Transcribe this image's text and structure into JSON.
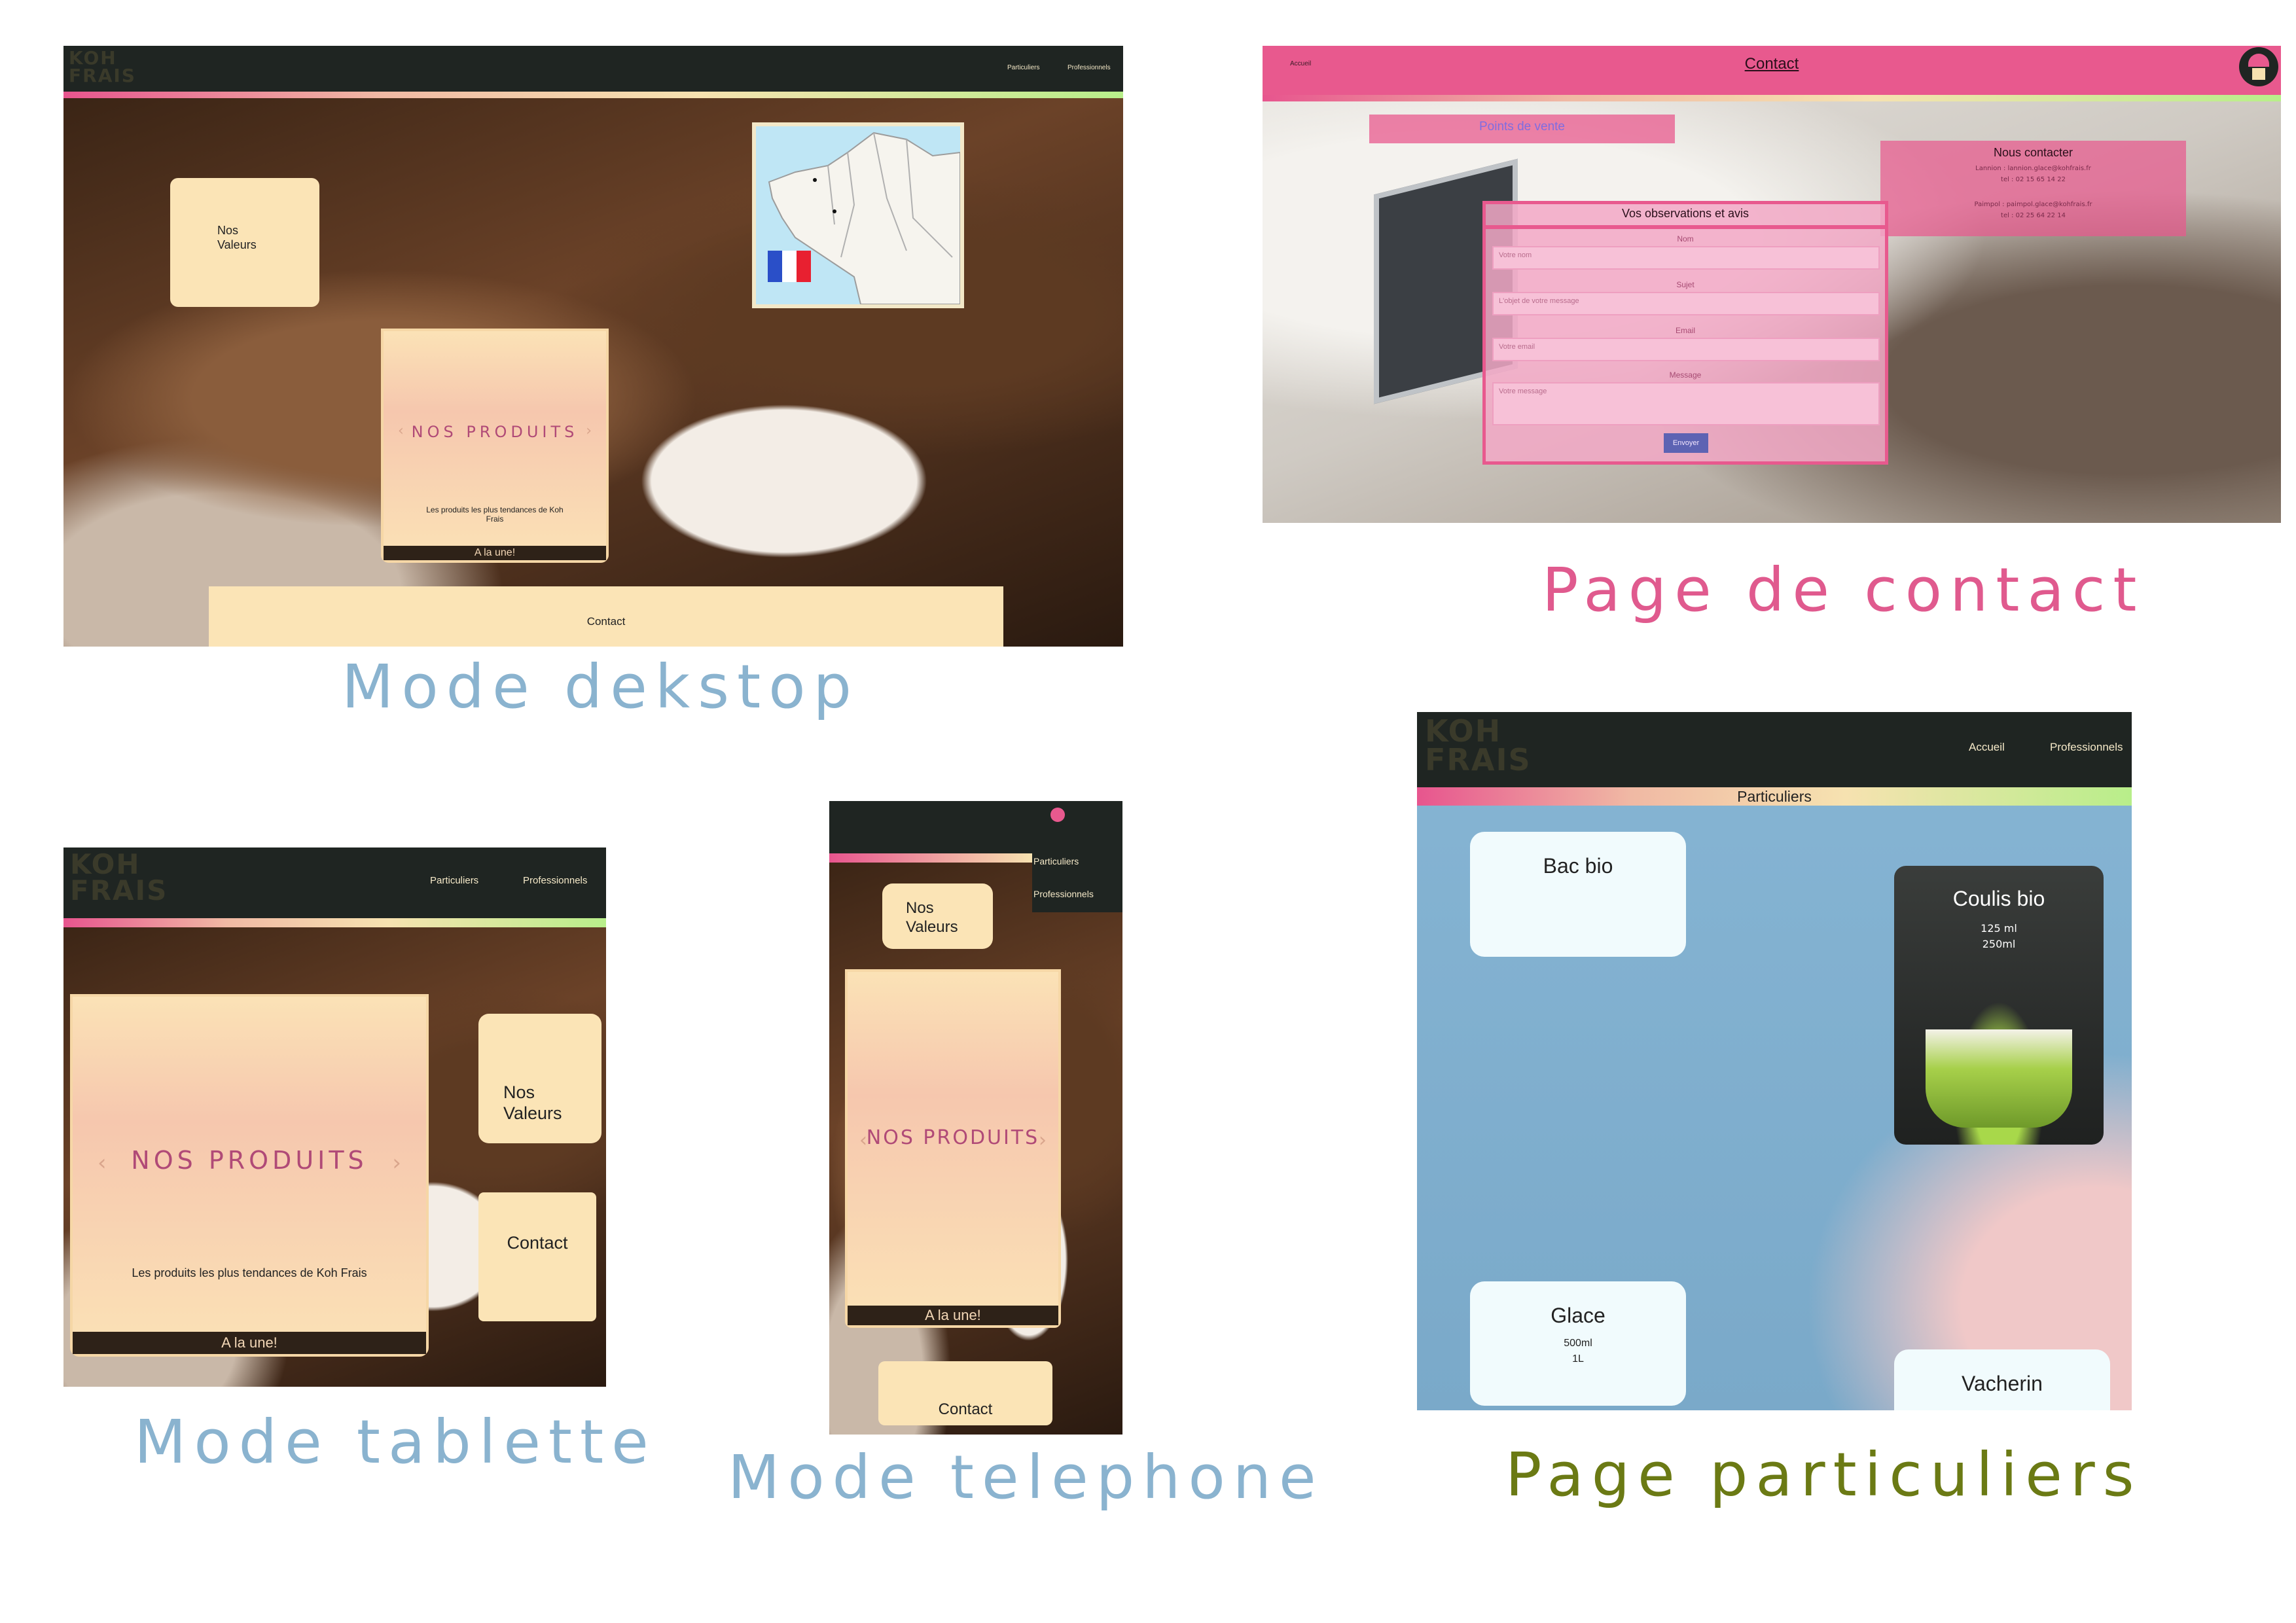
{
  "captions": {
    "desktop": "Mode dekstop",
    "contact": "Page de contact",
    "tablette": "Mode tablette",
    "telephone": "Mode telephone",
    "particuliers": "Page particuliers"
  },
  "colors": {
    "caption_blue": "#8ab3cf",
    "caption_pink": "#e05a8e",
    "caption_olive": "#6b7a14",
    "header_dark": "#1f2522",
    "cream": "#fbe4b6",
    "contact_pink": "#e8598e",
    "particuliers_blue": "#86b5d4"
  },
  "logo": {
    "line1": "KOH",
    "line2": "FRAIS"
  },
  "desktop": {
    "nav": [
      "Particuliers",
      "Professionnels"
    ],
    "nos_valeurs": "Nos\nValeurs",
    "produits_title": "NOS PRODUITS",
    "produits_desc": "Les produits les plus tendances de Koh Frais",
    "a_la_une": "A la une!",
    "contact": "Contact"
  },
  "contact_page": {
    "nav_home": "Accueil",
    "title": "Contact",
    "points_de_vente": "Points de vente",
    "nous_contacter": {
      "title": "Nous contacter",
      "lines": [
        "Lannion : lannion.glace@kohfrais.fr",
        "tel : 02 15 65 14 22",
        "Paimpol : paimpol.glace@kohfrais.fr",
        "tel : 02 25 64 22 14"
      ]
    },
    "form": {
      "title": "Vos observations et avis",
      "name_label": "Nom",
      "name_placeholder": "Votre nom",
      "subject_label": "Sujet",
      "subject_placeholder": "L'objet de votre message",
      "email_label": "Email",
      "email_placeholder": "Votre email",
      "message_label": "Message",
      "message_placeholder": "Votre message",
      "submit": "Envoyer"
    }
  },
  "tablette": {
    "nav": [
      "Particuliers",
      "Professionnels"
    ],
    "produits_title": "NOS PRODUITS",
    "produits_desc": "Les produits les plus tendances de Koh Frais",
    "a_la_une": "A la une!",
    "nos_valeurs": "Nos\nValeurs",
    "contact": "Contact"
  },
  "telephone": {
    "nav": [
      "Particuliers",
      "Professionnels"
    ],
    "nos_valeurs": "Nos\nValeurs",
    "produits_title": "NOS PRODUITS",
    "a_la_une": "A la une!",
    "contact": "Contact"
  },
  "particuliers": {
    "nav": [
      "Accueil",
      "Professionnels"
    ],
    "title": "Particuliers",
    "cards": {
      "bac_bio": {
        "name": "Bac bio"
      },
      "coulis_bio": {
        "name": "Coulis bio",
        "sizes": [
          "125 ml",
          "250ml"
        ]
      },
      "glace": {
        "name": "Glace",
        "sizes": [
          "500ml",
          "1L"
        ]
      },
      "vacherin": {
        "name": "Vacherin"
      }
    }
  }
}
